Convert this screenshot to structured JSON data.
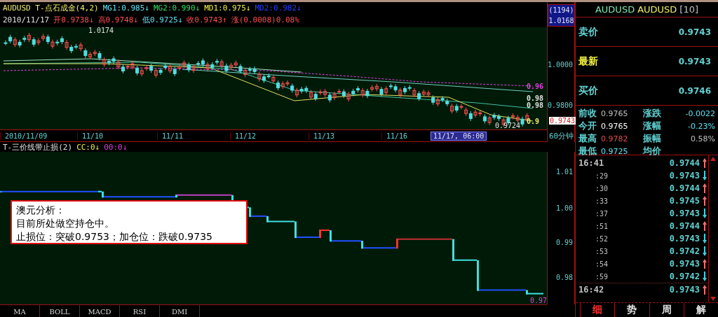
{
  "header": {
    "line1": [
      {
        "text": "AUDUSD T-点石成金(4,2)",
        "color": "#f0f070"
      },
      {
        "text": "MG1:0.985↓",
        "color": "#60e0f0"
      },
      {
        "text": "MG2:0.990↓",
        "color": "#30e060"
      },
      {
        "text": "MD1:0.975↓",
        "color": "#f0f040"
      },
      {
        "text": "MD2:0.982↓",
        "color": "#2040ff"
      }
    ],
    "line2": [
      {
        "text": "2010/11/17",
        "color": "#e0e0e0"
      },
      {
        "text": "开0.9738↓",
        "color": "#ff5050"
      },
      {
        "text": "高0.9748↓",
        "color": "#ff5050"
      },
      {
        "text": "低0.9725↓",
        "color": "#60e0f0"
      },
      {
        "text": "收0.9743↑",
        "color": "#ff5050"
      },
      {
        "text": "涨(0.0008)0.08%",
        "color": "#ff5050"
      }
    ]
  },
  "cursor_box": {
    "count": "(1194)",
    "price": "1.0168"
  },
  "top_chart": {
    "peak_label": "1.0174",
    "low_label": "0.9724",
    "line_labels": [
      {
        "text": "0.96",
        "color": "#e040e0"
      },
      {
        "text": "0.98",
        "color": "#e0e0e0"
      },
      {
        "text": "0.98",
        "color": "#e0e0e0"
      },
      {
        "text": "0.9",
        "color": "#f0f070"
      }
    ],
    "axis": [
      "1.0000",
      "0.9800"
    ],
    "last_price": "0.9743"
  },
  "date_axis": [
    {
      "text": "2010/11/09",
      "kind": "date"
    },
    {
      "text": "11/10",
      "kind": "date"
    },
    {
      "text": "11/11",
      "kind": "date"
    },
    {
      "text": "11/12",
      "kind": "date"
    },
    {
      "text": "11/13",
      "kind": "date"
    },
    {
      "text": "11/16",
      "kind": "date"
    },
    {
      "text": "11/17, 06:00",
      "kind": "cursor"
    }
  ],
  "period": "60分钟",
  "indicator": {
    "items": [
      {
        "text": "T-三价线带止损(2)",
        "color": "#e0e0e0"
      },
      {
        "text": "CC:0↓",
        "color": "#f0f040"
      },
      {
        "text": "00:0↓",
        "color": "#e040e0"
      }
    ],
    "axis": [
      "1.01",
      "1.00",
      "0.99",
      "0.98"
    ],
    "end_label": "0.97"
  },
  "note": {
    "title": "澳元分析：",
    "lines": [
      "目前所处做空持仓中。",
      "止损位：突破0.9753；加仓位：跌破0.9735"
    ]
  },
  "indicator_tabs": [
    "MA",
    "BOLL",
    "MACD",
    "RSI",
    "DMI"
  ],
  "panel": {
    "symbol": "AUDUSD",
    "name": "AUDUSD",
    "count": "[10]",
    "quotes": [
      {
        "label": "卖价",
        "value": "0.9743",
        "kind": "normal"
      },
      {
        "label": "最新",
        "value": "0.9743",
        "kind": "latest"
      },
      {
        "label": "买价",
        "value": "0.9746",
        "kind": "normal"
      }
    ],
    "stats": [
      {
        "label": "前收",
        "value": "0.9765",
        "color": "#c0c0c0"
      },
      {
        "label": "涨跌",
        "value": "-0.0022",
        "color": "#60e0f0"
      },
      {
        "label": "今开",
        "value": "0.9765",
        "color": "#ffffff"
      },
      {
        "label": "涨幅",
        "value": "-0.23%",
        "color": "#60e0f0"
      },
      {
        "label": "最高",
        "value": "0.9782",
        "color": "#e05050"
      },
      {
        "label": "振幅",
        "value": "0.58%",
        "color": "#c0c0c0"
      },
      {
        "label": "最低",
        "value": "0.9725",
        "color": "#60e0f0"
      },
      {
        "label": "均价"
      }
    ],
    "ticks": [
      {
        "time": "16:41",
        "kind": "minute",
        "price": "0.9744",
        "up": true
      },
      {
        "time": ":29",
        "kind": "second",
        "price": "0.9743",
        "up": false
      },
      {
        "time": ":30",
        "kind": "second",
        "price": "0.9744",
        "up": true
      },
      {
        "time": ":33",
        "kind": "second",
        "price": "0.9745",
        "up": true
      },
      {
        "time": ":37",
        "kind": "second",
        "price": "0.9743",
        "up": false
      },
      {
        "time": ":51",
        "kind": "second",
        "price": "0.9744",
        "up": true
      },
      {
        "time": ":52",
        "kind": "second",
        "price": "0.9743",
        "up": false
      },
      {
        "time": ":53",
        "kind": "second",
        "price": "0.9742",
        "up": false
      },
      {
        "time": ":54",
        "kind": "second",
        "price": "0.9743",
        "up": true
      },
      {
        "time": ":59",
        "kind": "second",
        "price": "0.9742",
        "up": false
      },
      {
        "time": "16:42",
        "kind": "minute",
        "price": "0.9743",
        "up": true
      }
    ],
    "tabs": [
      {
        "label": "细",
        "selected": true
      },
      {
        "label": "势",
        "selected": false
      },
      {
        "label": "周",
        "selected": false
      },
      {
        "label": "解",
        "selected": false
      }
    ]
  }
}
